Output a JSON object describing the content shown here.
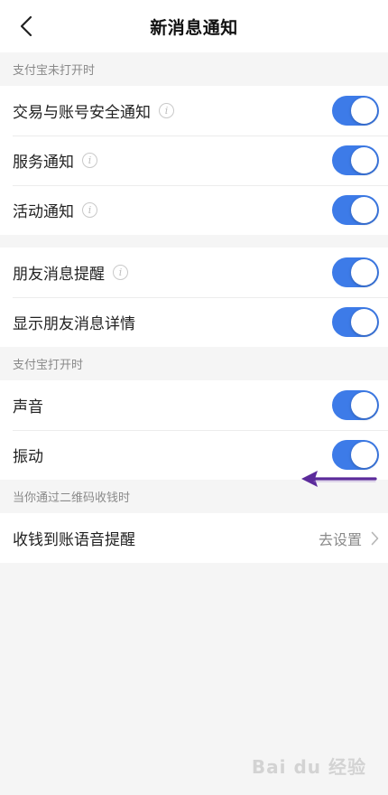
{
  "header": {
    "title": "新消息通知",
    "back_icon": "chevron-left-icon"
  },
  "sections": {
    "closed_header": "支付宝未打开时",
    "open_header": "支付宝打开时",
    "qr_header": "当你通过二维码收钱时"
  },
  "rows": {
    "trade_security": {
      "label": "交易与账号安全通知",
      "on": true
    },
    "service": {
      "label": "服务通知",
      "on": true
    },
    "activity": {
      "label": "活动通知",
      "on": true
    },
    "friend_msg": {
      "label": "朋友消息提醒",
      "on": true
    },
    "friend_detail": {
      "label": "显示朋友消息详情",
      "on": true
    },
    "sound": {
      "label": "声音",
      "on": true
    },
    "vibrate": {
      "label": "振动",
      "on": true
    },
    "voice_alert": {
      "label": "收钱到账语音提醒",
      "value": "去设置"
    }
  },
  "info_icon_glyph": "i",
  "watermark": "Bai du 经验",
  "colors": {
    "toggle_on": "#3d7be8",
    "arrow": "#5b2a9b",
    "background": "#f5f5f5"
  }
}
